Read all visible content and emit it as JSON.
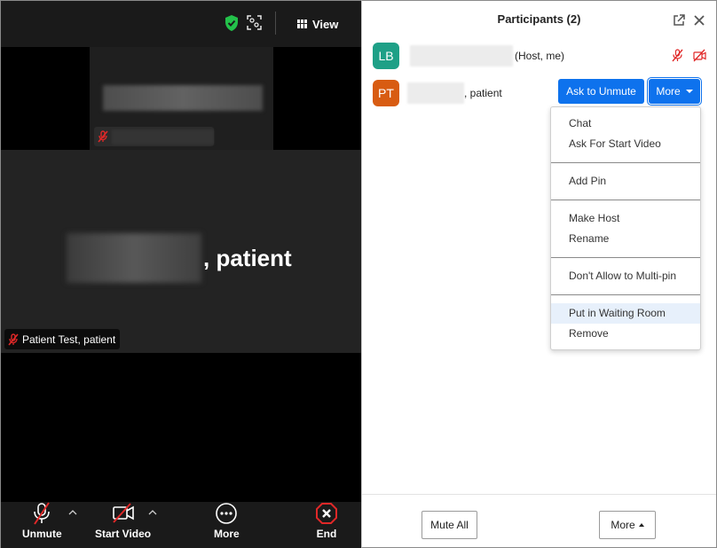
{
  "video": {
    "view_label": "View",
    "main_speaker_suffix": ", patient",
    "main_badge_name": "Patient Test, patient"
  },
  "toolbar": {
    "unmute_label": "Unmute",
    "start_video_label": "Start Video",
    "more_label": "More",
    "end_label": "End"
  },
  "panel": {
    "title": "Participants (2)",
    "participants": [
      {
        "initials": "LB",
        "suffix": "(Host, me)",
        "avatar_color": "#1ea087"
      },
      {
        "initials": "PT",
        "suffix": ", patient",
        "avatar_color": "#d85c12"
      }
    ],
    "ask_unmute_label": "Ask to Unmute",
    "more_label": "More",
    "menu": {
      "chat": "Chat",
      "ask_start_video": "Ask For Start Video",
      "add_pin": "Add Pin",
      "make_host": "Make Host",
      "rename": "Rename",
      "dont_allow_multipin": "Don't Allow to Multi-pin",
      "put_in_waiting_room": "Put in Waiting Room",
      "remove": "Remove"
    },
    "footer": {
      "mute_all_label": "Mute All",
      "more_label": "More"
    }
  },
  "colors": {
    "accent_blue": "#0e72ed",
    "muted_red": "#e02828",
    "secure_green": "#23c14a"
  }
}
